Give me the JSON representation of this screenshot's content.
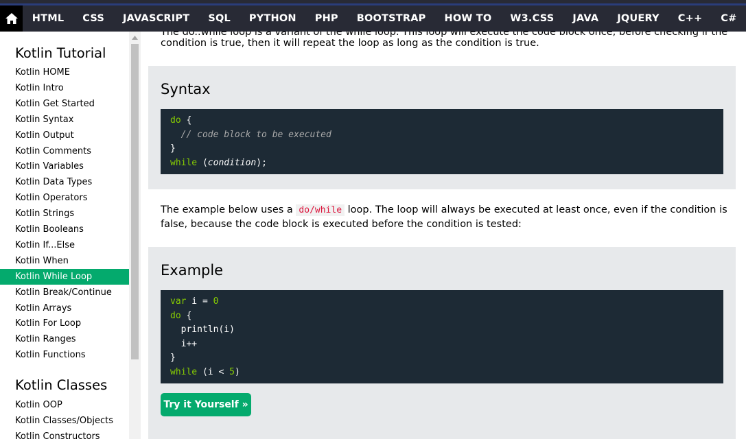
{
  "nav": {
    "home_icon": "home-icon",
    "items": [
      "HTML",
      "CSS",
      "JAVASCRIPT",
      "SQL",
      "PYTHON",
      "PHP",
      "BOOTSTRAP",
      "HOW TO",
      "W3.CSS",
      "JAVA",
      "JQUERY",
      "C++",
      "C#"
    ]
  },
  "sidebar": {
    "heading1": "Kotlin Tutorial",
    "items1": [
      "Kotlin HOME",
      "Kotlin Intro",
      "Kotlin Get Started",
      "Kotlin Syntax",
      "Kotlin Output",
      "Kotlin Comments",
      "Kotlin Variables",
      "Kotlin Data Types",
      "Kotlin Operators",
      "Kotlin Strings",
      "Kotlin Booleans",
      "Kotlin If...Else",
      "Kotlin When",
      "Kotlin While Loop",
      "Kotlin Break/Continue",
      "Kotlin Arrays",
      "Kotlin For Loop",
      "Kotlin Ranges",
      "Kotlin Functions"
    ],
    "active_item": "Kotlin While Loop",
    "heading2": "Kotlin Classes",
    "items2": [
      "Kotlin OOP",
      "Kotlin Classes/Objects",
      "Kotlin Constructors"
    ]
  },
  "content": {
    "intro_partial": "The do..while loop is a variant of the while loop. This loop will execute the code block once, before checking if the",
    "intro_line2": "condition is true, then it will repeat the loop as long as the condition is true.",
    "syntax_title": "Syntax",
    "syntax_code": {
      "l1_kw": "do",
      "l1_rest": " {",
      "l2": "  // code block to be executed",
      "l3": "}",
      "l4_kw": "while",
      "l4_rest": " (",
      "l4_cond": "condition",
      "l4_end": ");"
    },
    "example_text_before": "The example below uses a ",
    "example_text_code": "do/while",
    "example_text_after": " loop. The loop will always be executed at least once, even if the condition is false, because the code block is executed before the condition is tested:",
    "example_title": "Example",
    "example_code": {
      "l1_kw": "var",
      "l1_rest": " i = ",
      "l1_num": "0",
      "l2_kw": "do",
      "l2_rest": " {",
      "l3": "  println(i)",
      "l4": "  i++",
      "l5": "}",
      "l6_kw": "while",
      "l6_rest": " (i < ",
      "l6_num": "5",
      "l6_end": ")"
    },
    "try_button": "Try it Yourself »"
  },
  "colors": {
    "nav_bg": "#282a35",
    "accent_green": "#04aa6d",
    "code_bg": "#1d2a35",
    "panel_bg": "#e7e9eb"
  }
}
